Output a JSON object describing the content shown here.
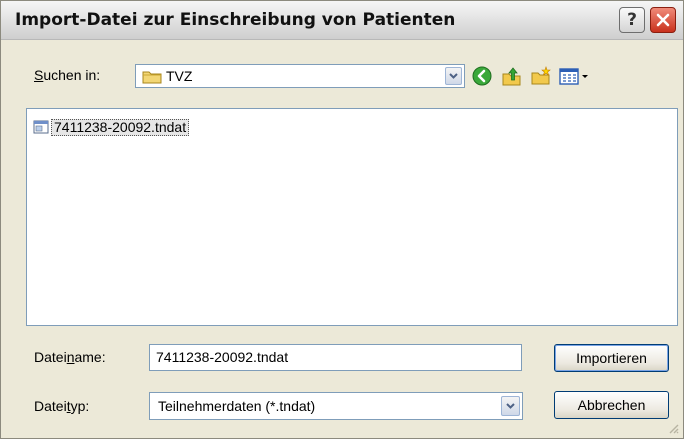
{
  "window": {
    "title": "Import-Datei zur Einschreibung von Patienten",
    "help_glyph": "?"
  },
  "lookin": {
    "label_accel": "S",
    "label_rest": "uchen in:",
    "value": "TVZ"
  },
  "toolbar": {
    "icons": [
      "back-icon",
      "up-folder-icon",
      "new-folder-icon",
      "view-menu-icon"
    ]
  },
  "files": [
    {
      "name": "7411238-20092.tndat",
      "selected": true
    }
  ],
  "filename": {
    "label_pre": "Datei",
    "label_accel": "n",
    "label_post": "ame:",
    "value": "7411238-20092.tndat"
  },
  "filetype": {
    "label_pre": "Datei",
    "label_accel": "t",
    "label_post": "yp:",
    "value": "Teilnehmerdaten (*.tndat)"
  },
  "buttons": {
    "import_label": "Importieren",
    "cancel_label": "Abbrechen"
  },
  "colors": {
    "dialog_bg": "#ece9d8",
    "border": "#7f9db9",
    "close_red": "#c9311d",
    "back_green": "#3aa83a",
    "folder_yellow": "#f2c94c"
  }
}
